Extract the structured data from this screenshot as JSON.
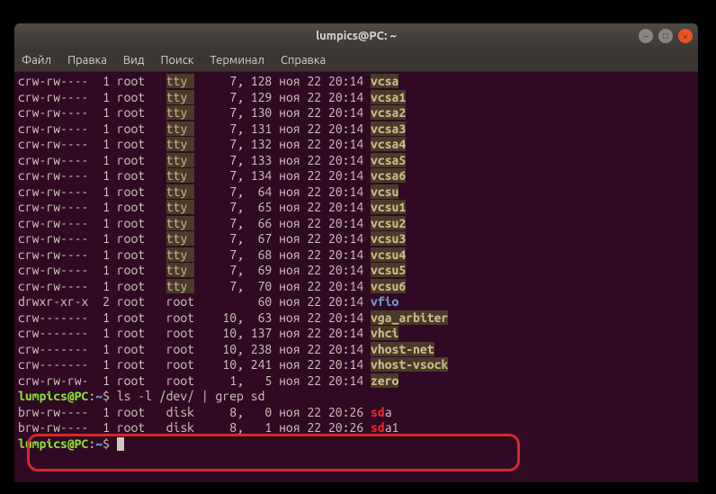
{
  "window": {
    "title": "lumpics@PC: ~"
  },
  "menu": {
    "file": "Файл",
    "edit": "Правка",
    "view": "Вид",
    "search": "Поиск",
    "terminal": "Терминал",
    "help": "Справка"
  },
  "rows": [
    {
      "perm": "crw-rw----",
      "links": "1",
      "owner": "root",
      "group": "tty",
      "grp_hl": true,
      "maj": "7,",
      "min": "128",
      "date": "ноя 22 20:14",
      "name": "vcsa",
      "cls": "dev-name"
    },
    {
      "perm": "crw-rw----",
      "links": "1",
      "owner": "root",
      "group": "tty",
      "grp_hl": true,
      "maj": "7,",
      "min": "129",
      "date": "ноя 22 20:14",
      "name": "vcsa1",
      "cls": "dev-name"
    },
    {
      "perm": "crw-rw----",
      "links": "1",
      "owner": "root",
      "group": "tty",
      "grp_hl": true,
      "maj": "7,",
      "min": "130",
      "date": "ноя 22 20:14",
      "name": "vcsa2",
      "cls": "dev-name"
    },
    {
      "perm": "crw-rw----",
      "links": "1",
      "owner": "root",
      "group": "tty",
      "grp_hl": true,
      "maj": "7,",
      "min": "131",
      "date": "ноя 22 20:14",
      "name": "vcsa3",
      "cls": "dev-name"
    },
    {
      "perm": "crw-rw----",
      "links": "1",
      "owner": "root",
      "group": "tty",
      "grp_hl": true,
      "maj": "7,",
      "min": "132",
      "date": "ноя 22 20:14",
      "name": "vcsa4",
      "cls": "dev-name"
    },
    {
      "perm": "crw-rw----",
      "links": "1",
      "owner": "root",
      "group": "tty",
      "grp_hl": true,
      "maj": "7,",
      "min": "133",
      "date": "ноя 22 20:14",
      "name": "vcsa5",
      "cls": "dev-name"
    },
    {
      "perm": "crw-rw----",
      "links": "1",
      "owner": "root",
      "group": "tty",
      "grp_hl": true,
      "maj": "7,",
      "min": "134",
      "date": "ноя 22 20:14",
      "name": "vcsa6",
      "cls": "dev-name"
    },
    {
      "perm": "crw-rw----",
      "links": "1",
      "owner": "root",
      "group": "tty",
      "grp_hl": true,
      "maj": "7,",
      "min": "64",
      "date": "ноя 22 20:14",
      "name": "vcsu",
      "cls": "dev-name"
    },
    {
      "perm": "crw-rw----",
      "links": "1",
      "owner": "root",
      "group": "tty",
      "grp_hl": true,
      "maj": "7,",
      "min": "65",
      "date": "ноя 22 20:14",
      "name": "vcsu1",
      "cls": "dev-name"
    },
    {
      "perm": "crw-rw----",
      "links": "1",
      "owner": "root",
      "group": "tty",
      "grp_hl": true,
      "maj": "7,",
      "min": "66",
      "date": "ноя 22 20:14",
      "name": "vcsu2",
      "cls": "dev-name"
    },
    {
      "perm": "crw-rw----",
      "links": "1",
      "owner": "root",
      "group": "tty",
      "grp_hl": true,
      "maj": "7,",
      "min": "67",
      "date": "ноя 22 20:14",
      "name": "vcsu3",
      "cls": "dev-name"
    },
    {
      "perm": "crw-rw----",
      "links": "1",
      "owner": "root",
      "group": "tty",
      "grp_hl": true,
      "maj": "7,",
      "min": "68",
      "date": "ноя 22 20:14",
      "name": "vcsu4",
      "cls": "dev-name"
    },
    {
      "perm": "crw-rw----",
      "links": "1",
      "owner": "root",
      "group": "tty",
      "grp_hl": true,
      "maj": "7,",
      "min": "69",
      "date": "ноя 22 20:14",
      "name": "vcsu5",
      "cls": "dev-name"
    },
    {
      "perm": "crw-rw----",
      "links": "1",
      "owner": "root",
      "group": "tty",
      "grp_hl": true,
      "maj": "7,",
      "min": "70",
      "date": "ноя 22 20:14",
      "name": "vcsu6",
      "cls": "dev-name"
    },
    {
      "perm": "drwxr-xr-x",
      "links": "2",
      "owner": "root",
      "group": "root",
      "grp_hl": false,
      "maj": "",
      "min": "60",
      "date": "ноя 22 20:14",
      "name": "vfio",
      "cls": "dev-vfio"
    },
    {
      "perm": "crw-------",
      "links": "1",
      "owner": "root",
      "group": "root",
      "grp_hl": false,
      "maj": "10,",
      "min": "63",
      "date": "ноя 22 20:14",
      "name": "vga_arbiter",
      "cls": "dev-name"
    },
    {
      "perm": "crw-------",
      "links": "1",
      "owner": "root",
      "group": "root",
      "grp_hl": false,
      "maj": "10,",
      "min": "137",
      "date": "ноя 22 20:14",
      "name": "vhci",
      "cls": "dev-name"
    },
    {
      "perm": "crw-------",
      "links": "1",
      "owner": "root",
      "group": "root",
      "grp_hl": false,
      "maj": "10,",
      "min": "238",
      "date": "ноя 22 20:14",
      "name": "vhost-net",
      "cls": "dev-name"
    },
    {
      "perm": "crw-------",
      "links": "1",
      "owner": "root",
      "group": "root",
      "grp_hl": false,
      "maj": "10,",
      "min": "241",
      "date": "ноя 22 20:14",
      "name": "vhost-vsock",
      "cls": "dev-name"
    },
    {
      "perm": "crw-rw-rw-",
      "links": "1",
      "owner": "root",
      "group": "root",
      "grp_hl": false,
      "maj": "1,",
      "min": "5",
      "date": "ноя 22 20:14",
      "name": "zero",
      "cls": "dev-name"
    }
  ],
  "prompt1": {
    "user": "lumpics@PC",
    "colon": ":",
    "path": "~",
    "sym": "$",
    "cmd": "ls -l /dev/ | grep sd"
  },
  "grep_rows": [
    {
      "perm": "brw-rw----",
      "links": "1",
      "owner": "root",
      "group": "disk",
      "maj": "8,",
      "min": "0",
      "date": "ноя 22 20:26",
      "match": "sd",
      "rest": "a"
    },
    {
      "perm": "brw-rw----",
      "links": "1",
      "owner": "root",
      "group": "disk",
      "maj": "8,",
      "min": "1",
      "date": "ноя 22 20:26",
      "match": "sd",
      "rest": "a1"
    }
  ],
  "prompt2": {
    "user": "lumpics@PC",
    "colon": ":",
    "path": "~",
    "sym": "$"
  }
}
